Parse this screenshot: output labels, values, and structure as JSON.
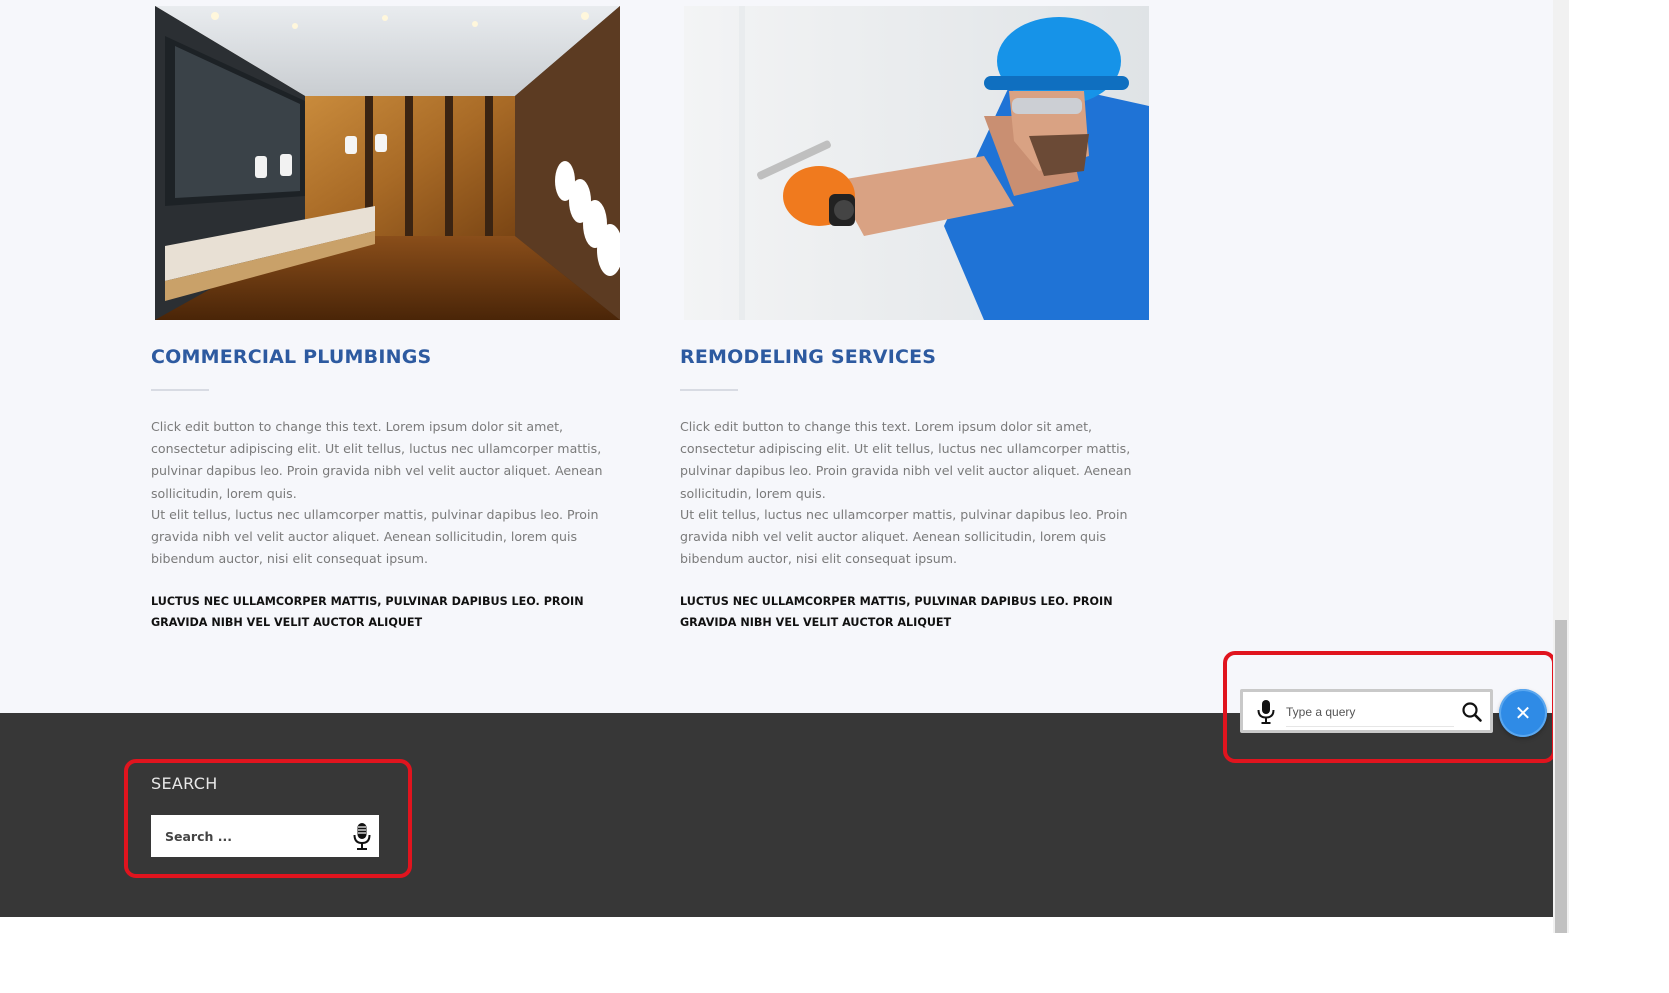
{
  "cards": [
    {
      "title": "COMMERCIAL PLUMBINGS",
      "paragraph1": "Click edit button to change this text. Lorem ipsum dolor sit amet, consectetur adipiscing elit. Ut elit tellus, luctus nec ullamcorper mattis, pulvinar dapibus leo. Proin gravida nibh vel velit auctor aliquet. Aenean sollicitudin, lorem quis.",
      "paragraph2": "Ut elit tellus, luctus nec ullamcorper mattis, pulvinar dapibus leo. Proin gravida nibh vel velit auctor aliquet. Aenean sollicitudin, lorem quis bibendum auctor, nisi elit consequat ipsum.",
      "emphasis": "LUCTUS NEC ULLAMCORPER MATTIS, PULVINAR DAPIBUS LEO. PROIN GRAVIDA NIBH VEL VELIT AUCTOR ALIQUET"
    },
    {
      "title": "REMODELING SERVICES",
      "paragraph1": "Click edit button to change this text. Lorem ipsum dolor sit amet, consectetur adipiscing elit. Ut elit tellus, luctus nec ullamcorper mattis, pulvinar dapibus leo. Proin gravida nibh vel velit auctor aliquet. Aenean sollicitudin, lorem quis.",
      "paragraph2": "Ut elit tellus, luctus nec ullamcorper mattis, pulvinar dapibus leo. Proin gravida nibh vel velit auctor aliquet. Aenean sollicitudin, lorem quis bibendum auctor, nisi elit consequat ipsum.",
      "emphasis": "LUCTUS NEC ULLAMCORPER MATTIS, PULVINAR DAPIBUS LEO. PROIN GRAVIDA NIBH VEL VELIT AUCTOR ALIQUET"
    }
  ],
  "footer": {
    "search_title": "SEARCH",
    "search_placeholder": "Search ...",
    "search_value": ""
  },
  "voice_widget": {
    "placeholder": "Type a query",
    "value": "",
    "close_glyph": "✕"
  },
  "colors": {
    "heading_blue": "#2d5aa0",
    "footer_bg": "#373737",
    "highlight_red": "#e0141e",
    "close_button_blue": "#2f8be6"
  },
  "icons": [
    "microphone-icon",
    "search-icon",
    "close-icon"
  ]
}
